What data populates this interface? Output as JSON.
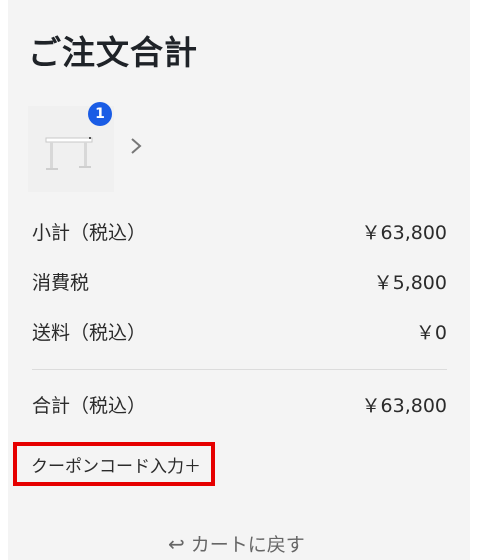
{
  "header": {
    "title": "ご注文合計"
  },
  "cart": {
    "item_count": "1"
  },
  "summary": {
    "subtotal_label": "小計（税込）",
    "subtotal_value": "￥63,800",
    "tax_label": "消費税",
    "tax_value": "￥5,800",
    "shipping_label": "送料（税込）",
    "shipping_value": "￥0",
    "total_label": "合計（税込）",
    "total_value": "￥63,800"
  },
  "coupon": {
    "label": "クーポンコード入力＋"
  },
  "footer": {
    "back_label": "カートに戻す",
    "back_icon": "return-arrow-icon"
  },
  "colors": {
    "accent": "#1a5ce5",
    "highlight": "#e60000"
  }
}
